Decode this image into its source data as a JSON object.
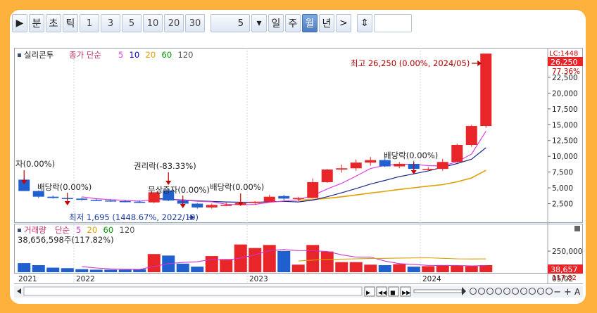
{
  "toolbar": {
    "play_icon": "play-icon",
    "buttons": [
      {
        "id": "min",
        "label": "분"
      },
      {
        "id": "sec",
        "label": "초"
      },
      {
        "id": "tick",
        "label": "틱"
      }
    ],
    "numbers": [
      "1",
      "3",
      "5",
      "10",
      "20",
      "30"
    ],
    "period_value": "5",
    "periods": [
      {
        "id": "day",
        "label": "일"
      },
      {
        "id": "week",
        "label": "주"
      },
      {
        "id": "month",
        "label": "월",
        "active": true
      },
      {
        "id": "year",
        "label": "년"
      }
    ],
    "more_label": ">",
    "split_icon": "split-arrows-icon"
  },
  "price_panel": {
    "legend_name": "실리콘투",
    "legend_type": "종가 단순",
    "ma_labels": [
      "5",
      "10",
      "20",
      "60",
      "120"
    ],
    "ma_colors": [
      "#e040e0",
      "#0000cc",
      "#e0a000",
      "#009900",
      "#555555"
    ],
    "lc_label": "LC:1448",
    "current_price": "26,250",
    "current_pct": "77.36%",
    "y_ticks": [
      "22,500",
      "20,000",
      "17,500",
      "15,000",
      "12,500",
      "10,000",
      "7,500",
      "5,000",
      "2,500"
    ],
    "high_note": "최고 26,250 (0.00%, 2024/05)",
    "low_note": "최저 1,695 (1448.67%, 2022/10)",
    "events": [
      "자(0.00%)",
      "배당락(0.00%)",
      "권리락(-83.33%)",
      "무상증자(0.00%)",
      "배당락(0.00%)",
      "배당락(0.00%)"
    ]
  },
  "volume_panel": {
    "legend_name": "거래량",
    "legend_type": "단순",
    "ma_labels": [
      "5",
      "20",
      "60",
      "120"
    ],
    "ma_colors": [
      "#cc33cc",
      "#e0a000",
      "#009900",
      "#555555"
    ],
    "value_note": "38,656,598주(117.82%)",
    "y_tick": "250,000",
    "current_value": "38,657",
    "current_pct": "117.82"
  },
  "x_axis": {
    "labels": [
      "2021",
      "2022",
      "2023",
      "2024"
    ],
    "last_date": "05/02"
  },
  "bottom_bar": {
    "zoom_out": "−",
    "zoom_in": "+",
    "auto": "A"
  },
  "chart_data": {
    "type": "candlestick",
    "series": [
      {
        "o": 6300,
        "h": 6800,
        "l": 4500,
        "c": 4500
      },
      {
        "o": 4500,
        "h": 4600,
        "l": 3400,
        "c": 3600
      },
      {
        "o": 3600,
        "h": 3800,
        "l": 3300,
        "c": 3400
      },
      {
        "o": 3400,
        "h": 3600,
        "l": 3100,
        "c": 3300
      },
      {
        "o": 3300,
        "h": 3500,
        "l": 3000,
        "c": 3100
      },
      {
        "o": 3100,
        "h": 3300,
        "l": 2900,
        "c": 3000
      },
      {
        "o": 3000,
        "h": 3200,
        "l": 2800,
        "c": 2900
      },
      {
        "o": 2900,
        "h": 3100,
        "l": 2700,
        "c": 2800
      },
      {
        "o": 2800,
        "h": 3000,
        "l": 2600,
        "c": 2700
      },
      {
        "o": 2700,
        "h": 4300,
        "l": 2600,
        "c": 4300
      },
      {
        "o": 4600,
        "h": 4800,
        "l": 2900,
        "c": 3000
      },
      {
        "o": 3000,
        "h": 3200,
        "l": 2500,
        "c": 2500
      },
      {
        "o": 2500,
        "h": 2600,
        "l": 1695,
        "c": 1900
      },
      {
        "o": 1900,
        "h": 2500,
        "l": 1700,
        "c": 2300
      },
      {
        "o": 2300,
        "h": 2700,
        "l": 2100,
        "c": 2300
      },
      {
        "o": 2300,
        "h": 2700,
        "l": 2200,
        "c": 2600
      },
      {
        "o": 2600,
        "h": 2900,
        "l": 2400,
        "c": 2800
      },
      {
        "o": 2800,
        "h": 3900,
        "l": 2700,
        "c": 3600
      },
      {
        "o": 3700,
        "h": 3900,
        "l": 3000,
        "c": 3300
      },
      {
        "o": 3300,
        "h": 3600,
        "l": 2900,
        "c": 3400
      },
      {
        "o": 3400,
        "h": 6500,
        "l": 3300,
        "c": 5900
      },
      {
        "o": 5900,
        "h": 8000,
        "l": 5800,
        "c": 7900
      },
      {
        "o": 7900,
        "h": 8700,
        "l": 7400,
        "c": 8100
      },
      {
        "o": 8100,
        "h": 9500,
        "l": 7700,
        "c": 9000
      },
      {
        "o": 9000,
        "h": 9900,
        "l": 8500,
        "c": 9400
      },
      {
        "o": 9400,
        "h": 10100,
        "l": 8300,
        "c": 8400
      },
      {
        "o": 8400,
        "h": 9100,
        "l": 8100,
        "c": 8800
      },
      {
        "o": 8800,
        "h": 9300,
        "l": 7800,
        "c": 8000
      },
      {
        "o": 8000,
        "h": 8300,
        "l": 7800,
        "c": 8000
      },
      {
        "o": 8000,
        "h": 9600,
        "l": 7700,
        "c": 9100
      },
      {
        "o": 9100,
        "h": 12000,
        "l": 9000,
        "c": 11800
      },
      {
        "o": 11800,
        "h": 15000,
        "l": 11500,
        "c": 14800
      },
      {
        "o": 14800,
        "h": 26250,
        "l": 14500,
        "c": 26250
      }
    ],
    "volume": [
      1.8,
      1.4,
      0.9,
      0.8,
      0.6,
      0.5,
      0.5,
      0.5,
      0.6,
      3.6,
      3.3,
      1.7,
      1.1,
      3.2,
      2.6,
      5.5,
      4.8,
      5.4,
      4.2,
      1.5,
      5.4,
      4.1,
      2.0,
      2.0,
      1.5,
      1.4,
      1.6,
      1.1,
      1.2,
      1.4,
      1.3,
      1.2,
      1.4
    ],
    "y_range": [
      0,
      26500
    ],
    "x_labels": [
      "2021",
      "2022",
      "2023",
      "2024"
    ]
  }
}
